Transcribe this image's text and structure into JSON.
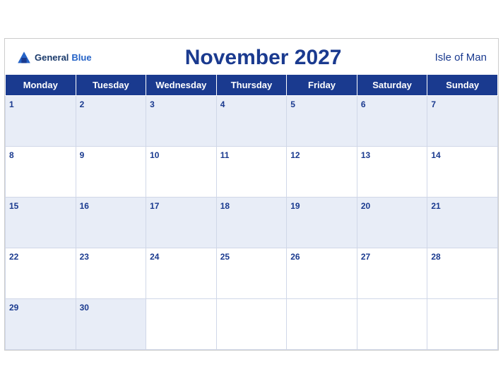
{
  "header": {
    "logo_general": "General",
    "logo_blue": "Blue",
    "title": "November 2027",
    "region": "Isle of Man"
  },
  "days_of_week": [
    "Monday",
    "Tuesday",
    "Wednesday",
    "Thursday",
    "Friday",
    "Saturday",
    "Sunday"
  ],
  "weeks": [
    [
      1,
      2,
      3,
      4,
      5,
      6,
      7
    ],
    [
      8,
      9,
      10,
      11,
      12,
      13,
      14
    ],
    [
      15,
      16,
      17,
      18,
      19,
      20,
      21
    ],
    [
      22,
      23,
      24,
      25,
      26,
      27,
      28
    ],
    [
      29,
      30,
      null,
      null,
      null,
      null,
      null
    ]
  ]
}
